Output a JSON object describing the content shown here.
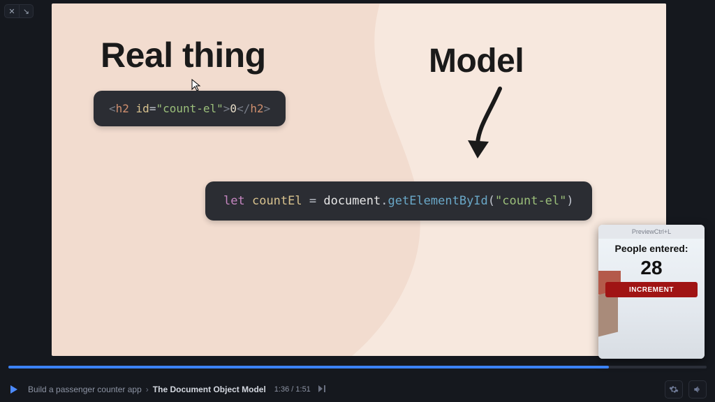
{
  "slide": {
    "heading_left": "Real thing",
    "heading_right": "Model",
    "code_html": {
      "open_angle": "<",
      "tag_open": "h2",
      "space": " ",
      "attr": "id",
      "eq": "=",
      "str": "\"count-el\"",
      "close_angle": ">",
      "text": "0",
      "open_angle2": "</",
      "tag_close": "h2",
      "close_angle2": ">"
    },
    "code_js": {
      "kw": "let",
      "space": " ",
      "var": "countEl",
      "eq": " = ",
      "obj": "document",
      "dot": ".",
      "fn": "getElementById",
      "par_open": "(",
      "arg": "\"count-el\"",
      "par_close": ")"
    }
  },
  "preview": {
    "header": "PreviewCtrl+L",
    "title": "People entered:",
    "count": "28",
    "button": "INCREMENT"
  },
  "playback": {
    "progress_pct": 86,
    "course": "Build a passenger counter app",
    "lesson": "The Document Object Model",
    "time_current": "1:36",
    "time_total": "1:51"
  },
  "icons": {
    "close": "✕",
    "expand": "↘",
    "gear": "gear",
    "volume": "volume"
  }
}
